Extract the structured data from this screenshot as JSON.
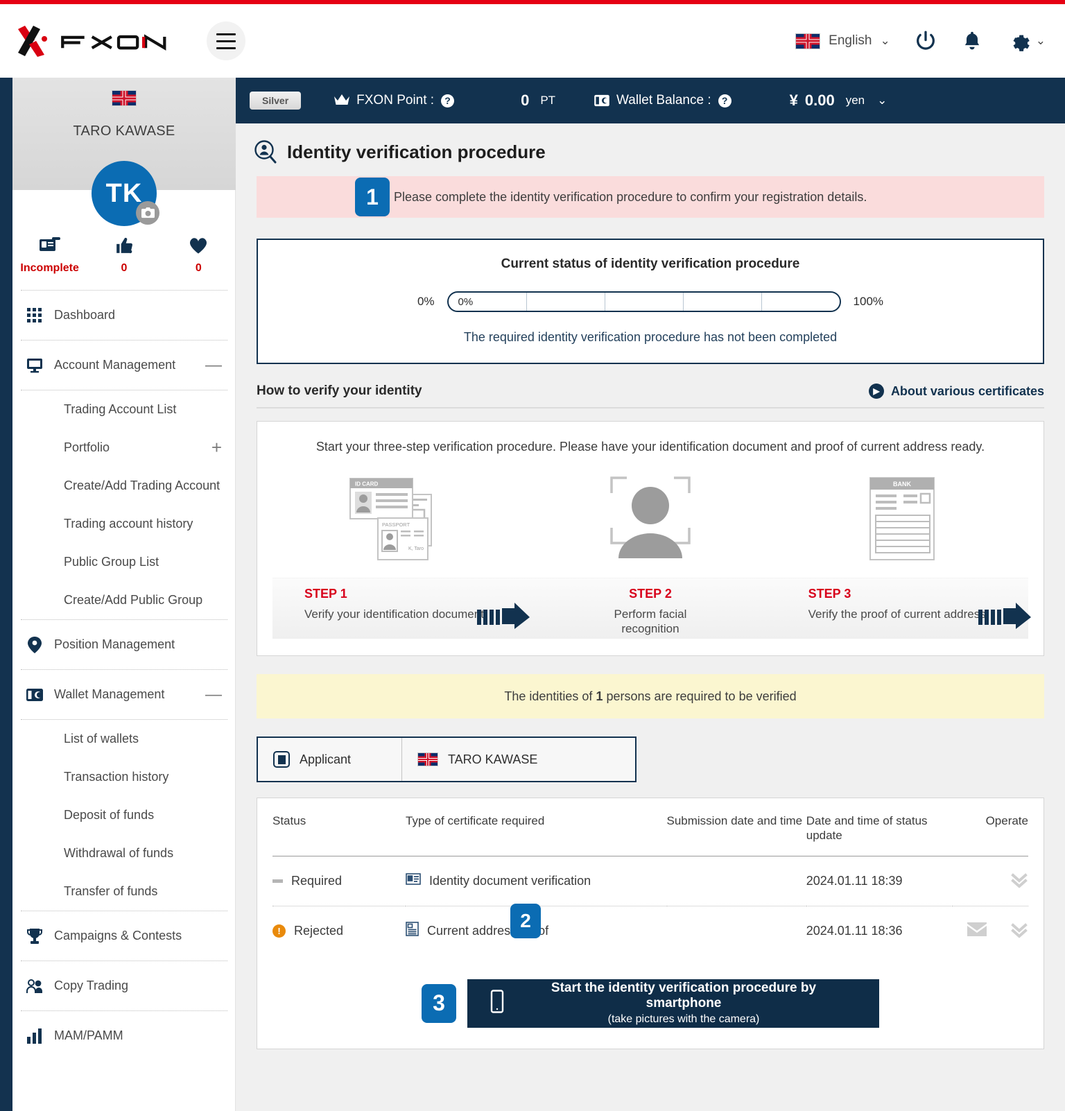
{
  "header": {
    "logo_text": "FXON",
    "menu_icon": "hamburger-icon",
    "language": "English",
    "power_icon": "power-icon",
    "bell_icon": "bell-icon",
    "gear_icon": "gear-icon"
  },
  "sidebar": {
    "user_name": "TARO KAWASE",
    "avatar_initials": "TK",
    "stats": [
      {
        "icon": "id-card-icon",
        "value": "Incomplete"
      },
      {
        "icon": "thumbs-up-icon",
        "value": "0"
      },
      {
        "icon": "heart-icon",
        "value": "0"
      }
    ],
    "menu": [
      {
        "label": "Dashboard",
        "icon": "grid-icon",
        "tail": ""
      },
      {
        "label": "Account Management",
        "icon": "monitor-icon",
        "tail": "—"
      },
      {
        "label": "Position Management",
        "icon": "pin-icon",
        "tail": ""
      },
      {
        "label": "Wallet Management",
        "icon": "wallet-icon",
        "tail": "—"
      },
      {
        "label": "Campaigns & Contests",
        "icon": "trophy-icon",
        "tail": ""
      },
      {
        "label": "Copy Trading",
        "icon": "people-icon",
        "tail": ""
      },
      {
        "label": "MAM/PAMM",
        "icon": "bar-chart-icon",
        "tail": ""
      }
    ],
    "account_sub": [
      {
        "label": "Trading Account List",
        "tail": ""
      },
      {
        "label": "Portfolio",
        "tail": "+"
      },
      {
        "label": "Create/Add Trading Account",
        "tail": ""
      },
      {
        "label": "Trading account history",
        "tail": ""
      },
      {
        "label": "Public Group List",
        "tail": ""
      },
      {
        "label": "Create/Add Public Group",
        "tail": ""
      }
    ],
    "wallet_sub": [
      {
        "label": "List of wallets",
        "tail": ""
      },
      {
        "label": "Transaction history",
        "tail": ""
      },
      {
        "label": "Deposit of funds",
        "tail": ""
      },
      {
        "label": "Withdrawal of funds",
        "tail": ""
      },
      {
        "label": "Transfer of funds",
        "tail": ""
      }
    ]
  },
  "statusbar": {
    "tier": "Silver",
    "point_label": "FXON Point :",
    "point_value": "0",
    "point_unit": "PT",
    "wallet_label": "Wallet Balance :",
    "wallet_symbol": "¥",
    "wallet_value": "0.00",
    "wallet_unit": "yen",
    "help_icon": "question-mark-icon",
    "crown_icon": "crown-icon",
    "wallet_icon": "wallet-icon",
    "chevron_icon": "chevron-down-icon"
  },
  "page": {
    "title": "Identity verification procedure",
    "title_icon": "identity-search-icon",
    "alert": {
      "badge": "1",
      "text": "Please complete the identity verification procedure to confirm your registration details."
    },
    "status_card": {
      "title": "Current status of identity verification procedure",
      "min_label": "0%",
      "max_label": "100%",
      "progress_label": "0%",
      "progress_percent": 0,
      "note": "The required identity verification procedure has not been completed"
    },
    "how_to": {
      "heading": "How to verify your identity",
      "about_link": "About various certificates",
      "about_icon": "chevron-right-circle-icon",
      "lead": "Start your three-step verification procedure. Please have your identification document and proof of current address ready.",
      "steps": [
        {
          "num": "STEP 1",
          "desc": "Verify your identification document",
          "art": "id-card-passport-illustration",
          "art_labels": {
            "card": "ID CARD",
            "passport": "PASSPORT",
            "signature": "K, Taro"
          }
        },
        {
          "num": "STEP 2",
          "desc": "Perform facial recognition",
          "art": "face-scan-illustration",
          "art_labels": {}
        },
        {
          "num": "STEP 3",
          "desc": "Verify the proof of current address",
          "art": "bank-statement-illustration",
          "art_labels": {
            "bank": "BANK"
          }
        }
      ]
    },
    "persons_notice_pre": "The identities of",
    "persons_notice_count": "1",
    "persons_notice_post": "persons are required to be verified",
    "applicant_tab": {
      "role_label": "Applicant",
      "role_icon": "person-card-icon",
      "name": "TARO KAWASE"
    },
    "table": {
      "columns": [
        "Status",
        "Type of certificate required",
        "Submission date and time",
        "Date and time of status update",
        "Operate"
      ],
      "rows": [
        {
          "status": "Required",
          "status_icon": "dash-icon",
          "type": "Identity document verification",
          "type_icon": "id-card-icon",
          "submitted": "",
          "updated": "2024.01.11 18:39",
          "has_mail": false,
          "expand_icon": "double-chevron-down-icon",
          "badge": ""
        },
        {
          "status": "Rejected",
          "status_icon": "warning-icon",
          "type": "Current address proof",
          "type_icon": "document-icon",
          "submitted": "",
          "updated": "2024.01.11 18:36",
          "has_mail": true,
          "mail_icon": "envelope-icon",
          "expand_icon": "double-chevron-down-icon",
          "badge": "2"
        }
      ]
    },
    "cta": {
      "badge": "3",
      "icon": "smartphone-icon",
      "line1": "Start the identity verification procedure by smartphone",
      "line2": "(take pictures with the camera)"
    }
  },
  "colors": {
    "brand_red": "#e60013",
    "navy": "#12324f",
    "accent_blue": "#0b6cb3",
    "alert_pink": "#fadcdc",
    "notice_yellow": "#fbf6d0",
    "step_red": "#d8001b",
    "warning_orange": "#e98a0b"
  }
}
